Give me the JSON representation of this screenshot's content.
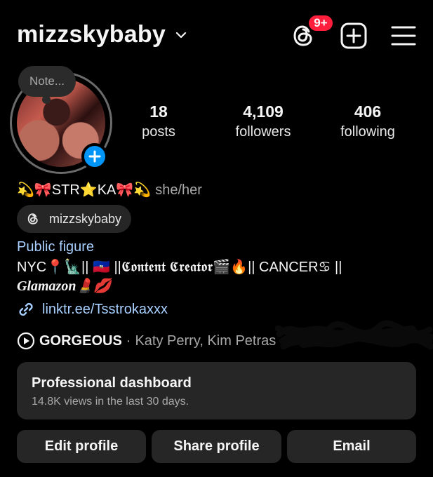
{
  "header": {
    "username": "mizzskybaby",
    "notification_badge": "9+",
    "icons": [
      "chevron-down-icon",
      "threads-icon",
      "create-plus-icon",
      "menu-icon"
    ]
  },
  "profile": {
    "note_placeholder": "Note...",
    "stats": [
      {
        "value": "18",
        "label": "posts"
      },
      {
        "value": "4,109",
        "label": "followers"
      },
      {
        "value": "406",
        "label": "following"
      }
    ],
    "display_name": "💫🎀STR⭐KA🎀💫",
    "pronouns": "she/her",
    "threads_handle": "mizzskybaby",
    "category": "Public figure",
    "bio_line_1": "NYC📍🗽|| 🇭🇹 ||𝕮𝖔𝖓𝖙𝖊𝖓𝖙 𝕮𝖗𝖊𝖆𝖙𝖔𝖗🎬🔥|| CANCER♋ ||",
    "bio_line_2": "Glamazon💄💋",
    "link": "linktr.ee/Tsstrokaxxx",
    "music": {
      "title": "GORGEOUS",
      "separator": "·",
      "artists": "Katy Perry, Kim Petras"
    }
  },
  "dashboard": {
    "title": "Professional dashboard",
    "subtitle": "14.8K views in the last 30 days."
  },
  "actions": {
    "edit": "Edit profile",
    "share": "Share profile",
    "email": "Email"
  },
  "colors": {
    "background": "#000000",
    "card": "#262626",
    "link": "#a8d0ff",
    "accent_blue": "#0095f6",
    "badge_red": "#ff1f3d",
    "muted": "#a8a8a8"
  }
}
